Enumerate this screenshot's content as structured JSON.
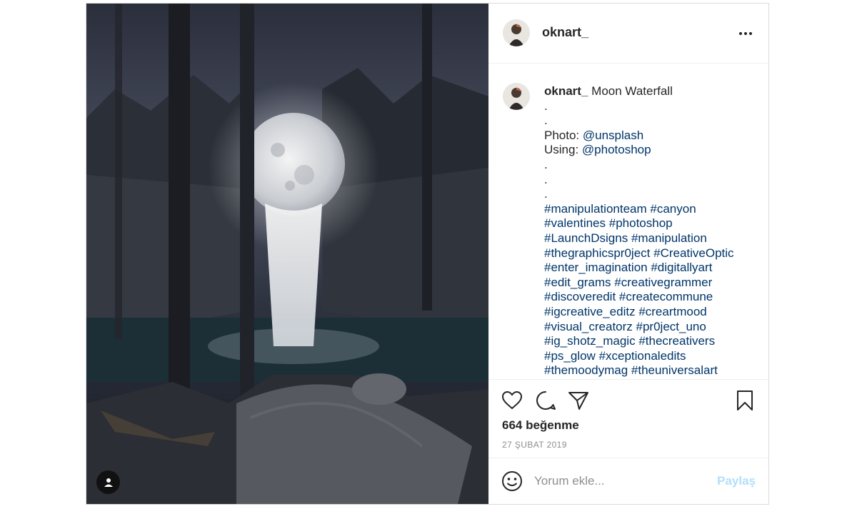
{
  "post": {
    "username": "oknart_",
    "caption_title": "Moon Waterfall",
    "caption_lines": [
      [
        {
          "text": "."
        }
      ],
      [
        {
          "text": "."
        }
      ],
      [
        {
          "text": "Photo: "
        },
        {
          "text": "@unsplash",
          "link": true
        }
      ],
      [
        {
          "text": "Using: "
        },
        {
          "text": "@photoshop",
          "link": true
        }
      ],
      [
        {
          "text": "."
        }
      ],
      [
        {
          "text": "."
        }
      ],
      [
        {
          "text": "."
        }
      ],
      [
        {
          "text": "#manipulationteam",
          "link": true
        },
        {
          "text": " "
        },
        {
          "text": "#canyon",
          "link": true
        }
      ],
      [
        {
          "text": "#valentines",
          "link": true
        },
        {
          "text": " "
        },
        {
          "text": "#photoshop",
          "link": true
        }
      ],
      [
        {
          "text": "#LaunchDsigns",
          "link": true
        },
        {
          "text": " "
        },
        {
          "text": "#manipulation",
          "link": true
        }
      ],
      [
        {
          "text": "#thegraphicspr0ject",
          "link": true
        },
        {
          "text": " "
        },
        {
          "text": "#CreativeOptic",
          "link": true
        }
      ],
      [
        {
          "text": "#enter_imagination",
          "link": true
        },
        {
          "text": " "
        },
        {
          "text": "#digitallyart",
          "link": true
        }
      ],
      [
        {
          "text": "#edit_grams",
          "link": true
        },
        {
          "text": " "
        },
        {
          "text": "#creativegrammer",
          "link": true
        }
      ],
      [
        {
          "text": "#discoveredit",
          "link": true
        },
        {
          "text": " "
        },
        {
          "text": "#createcommune",
          "link": true
        }
      ],
      [
        {
          "text": "#igcreative_editz",
          "link": true
        },
        {
          "text": " "
        },
        {
          "text": "#creartmood",
          "link": true
        }
      ],
      [
        {
          "text": "#visual_creatorz",
          "link": true
        },
        {
          "text": " "
        },
        {
          "text": "#pr0ject_uno",
          "link": true
        }
      ],
      [
        {
          "text": "#ig_shotz_magic",
          "link": true
        },
        {
          "text": " "
        },
        {
          "text": "#thecreativers",
          "link": true
        }
      ],
      [
        {
          "text": "#ps_glow",
          "link": true
        },
        {
          "text": " "
        },
        {
          "text": "#xceptionaledits",
          "link": true
        }
      ],
      [
        {
          "text": "#themoodymag",
          "link": true
        },
        {
          "text": " "
        },
        {
          "text": "#theuniversalart",
          "link": true
        }
      ]
    ],
    "likes": "664 beğenme",
    "date": "27 ŞUBAT 2019"
  },
  "comment": {
    "placeholder": "Yorum ekle...",
    "post_label": "Paylaş"
  },
  "colors": {
    "link": "#003569",
    "post_disabled": "#b2dffc",
    "muted": "#8e8e8e"
  },
  "icons": [
    "more-options-icon",
    "heart-icon",
    "comment-icon",
    "share-icon",
    "bookmark-icon",
    "emoji-icon",
    "user-tag-icon"
  ]
}
